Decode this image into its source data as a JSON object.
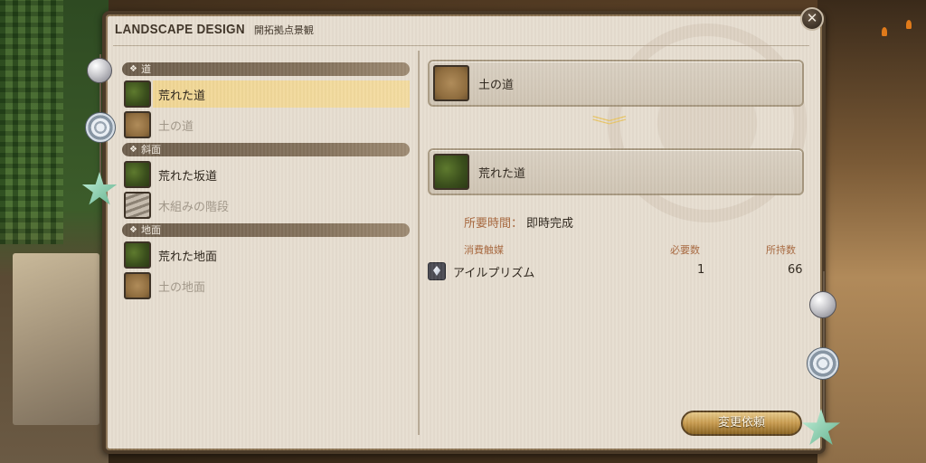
{
  "window": {
    "title": "LANDSCAPE DESIGN",
    "subtitle": "開拓拠点景観",
    "close_icon": "close-icon"
  },
  "categories": [
    {
      "name": "道",
      "items": [
        {
          "label": "荒れた道",
          "thumb": "grass",
          "selected": true,
          "dim": false
        },
        {
          "label": "土の道",
          "thumb": "dirt",
          "selected": false,
          "dim": true
        }
      ]
    },
    {
      "name": "斜面",
      "items": [
        {
          "label": "荒れた坂道",
          "thumb": "grass",
          "selected": false,
          "dim": false
        },
        {
          "label": "木組みの階段",
          "thumb": "stair",
          "selected": false,
          "dim": true
        }
      ]
    },
    {
      "name": "地面",
      "items": [
        {
          "label": "荒れた地面",
          "thumb": "grass",
          "selected": false,
          "dim": false
        },
        {
          "label": "土の地面",
          "thumb": "dirt",
          "selected": false,
          "dim": true
        }
      ]
    }
  ],
  "detail": {
    "from": {
      "label": "土の道",
      "thumb": "dirt"
    },
    "to": {
      "label": "荒れた道",
      "thumb": "grass"
    },
    "time_label": "所要時間：",
    "time_value": "即時完成",
    "materials_header": {
      "name": "消費触媒",
      "required": "必要数",
      "owned": "所持数"
    },
    "materials": [
      {
        "name": "アイルプリズム",
        "required": "1",
        "owned": "66",
        "icon": "prism-icon"
      }
    ],
    "request_button": "変更依頼"
  },
  "colors": {
    "accent_label": "#a8683e",
    "selected_row": "#f3dba0",
    "button_gold": "#c79a4e"
  }
}
